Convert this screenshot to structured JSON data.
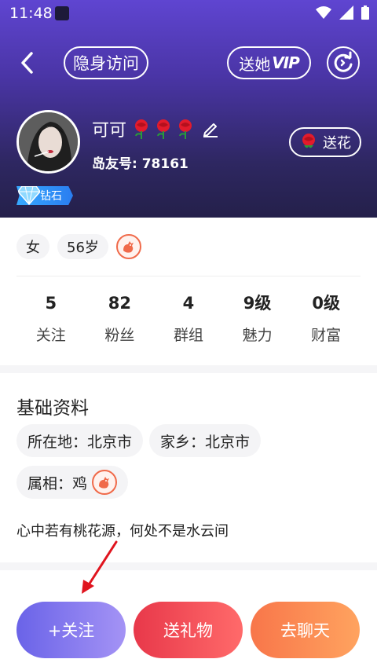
{
  "status_bar": {
    "time": "11:48"
  },
  "header": {
    "hidden_visit_label": "隐身访问",
    "send_vip_prefix": "送她",
    "send_vip_suffix": "VIP",
    "send_flower_label": "送花"
  },
  "profile": {
    "name": "可可",
    "island_id": "岛友号: 78161",
    "badge": "钻石",
    "tags": [
      "女",
      "56岁"
    ]
  },
  "stats": [
    {
      "value": "5",
      "label": "关注"
    },
    {
      "value": "82",
      "label": "粉丝"
    },
    {
      "value": "4",
      "label": "群组"
    },
    {
      "value": "9级",
      "label": "魅力"
    },
    {
      "value": "0级",
      "label": "财富"
    }
  ],
  "basic_info": {
    "title": "基础资料",
    "location": "所在地：北京市",
    "hometown": "家乡：北京市",
    "zodiac": "属相：鸡",
    "signature": "心中若有桃花源，何处不是水云间"
  },
  "actions": {
    "follow": "+关注",
    "gift": "送礼物",
    "chat": "去聊天"
  },
  "colors": {
    "header_top": "#5f45d1",
    "header_bottom": "#24204a",
    "follow_btn": "#6a63e8",
    "gift_btn": "#e8384a",
    "chat_btn": "#f8764a"
  }
}
